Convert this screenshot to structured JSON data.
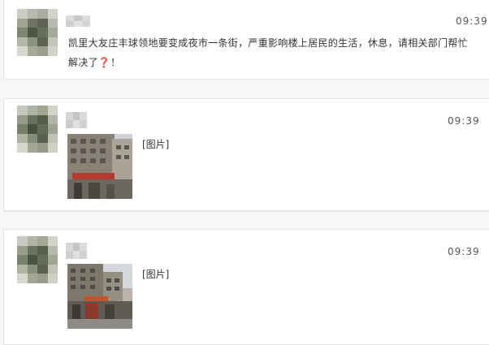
{
  "messages": [
    {
      "time": "09:39",
      "text": "凯里大友庄丰球领地要变成夜市一条街，严重影响楼上居民的生活，休息，请相关部门帮忙解决了",
      "emoji": "❓",
      "suffix": "！"
    },
    {
      "time": "09:39",
      "image_label": "[图片]"
    },
    {
      "time": "09:39",
      "image_label": "[图片]"
    }
  ]
}
